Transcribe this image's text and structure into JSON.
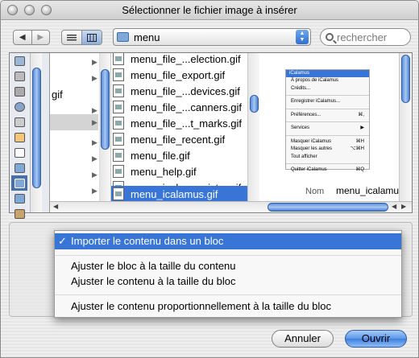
{
  "window": {
    "title": "Sélectionner le fichier image à insérer"
  },
  "toolbar": {
    "back_glyph": "◀",
    "forward_glyph": "▶",
    "view_list_icon": "list-view-icon",
    "view_columns_icon": "column-view-icon",
    "path_value": "menu",
    "search_placeholder": "rechercher"
  },
  "browser": {
    "parent_fragment": "gif",
    "files": [
      "menu_file_...election.gif",
      "menu_file_export.gif",
      "menu_file_...devices.gif",
      "menu_file_...canners.gif",
      "menu_file_...t_marks.gif",
      "menu_file_recent.gif",
      "menu_file.gif",
      "menu_help.gif",
      "menu_ical..._register.gif",
      "menu_icalamus.gif"
    ],
    "selected_file_index": 9
  },
  "preview": {
    "menu_title": "iCalamus",
    "items": [
      {
        "label": "À propos de iCalamus",
        "shortcut": ""
      },
      {
        "label": "Crédits...",
        "shortcut": ""
      },
      {
        "sep": true
      },
      {
        "label": "Enregistrer iCalamus...",
        "shortcut": ""
      },
      {
        "sep": true
      },
      {
        "label": "Préférences...",
        "shortcut": "⌘,"
      },
      {
        "sep": true
      },
      {
        "label": "Services",
        "shortcut": "▶"
      },
      {
        "sep": true
      },
      {
        "label": "Masquer iCalamus",
        "shortcut": "⌘H"
      },
      {
        "label": "Masquer les autres",
        "shortcut": "⌥⌘H"
      },
      {
        "label": "Tout afficher",
        "shortcut": ""
      },
      {
        "sep": true
      },
      {
        "label": "Quitter iCalamus",
        "shortcut": "⌘Q"
      }
    ],
    "name_label": "Nom",
    "name_value": "menu_icalamus.gif"
  },
  "popup_menu": {
    "selected_check": "✓",
    "items": [
      "Importer le contenu dans un bloc",
      "Ajuster le bloc à la taille du contenu",
      "Ajuster le contenu à la taille du bloc",
      "Ajuster le contenu proportionnellement à la taille du bloc"
    ],
    "selected_index": 0
  },
  "buttons": {
    "cancel": "Annuler",
    "open": "Ouvrir"
  },
  "colors": {
    "selection": "#3875d7",
    "aqua_blue": "#5a98ea"
  }
}
